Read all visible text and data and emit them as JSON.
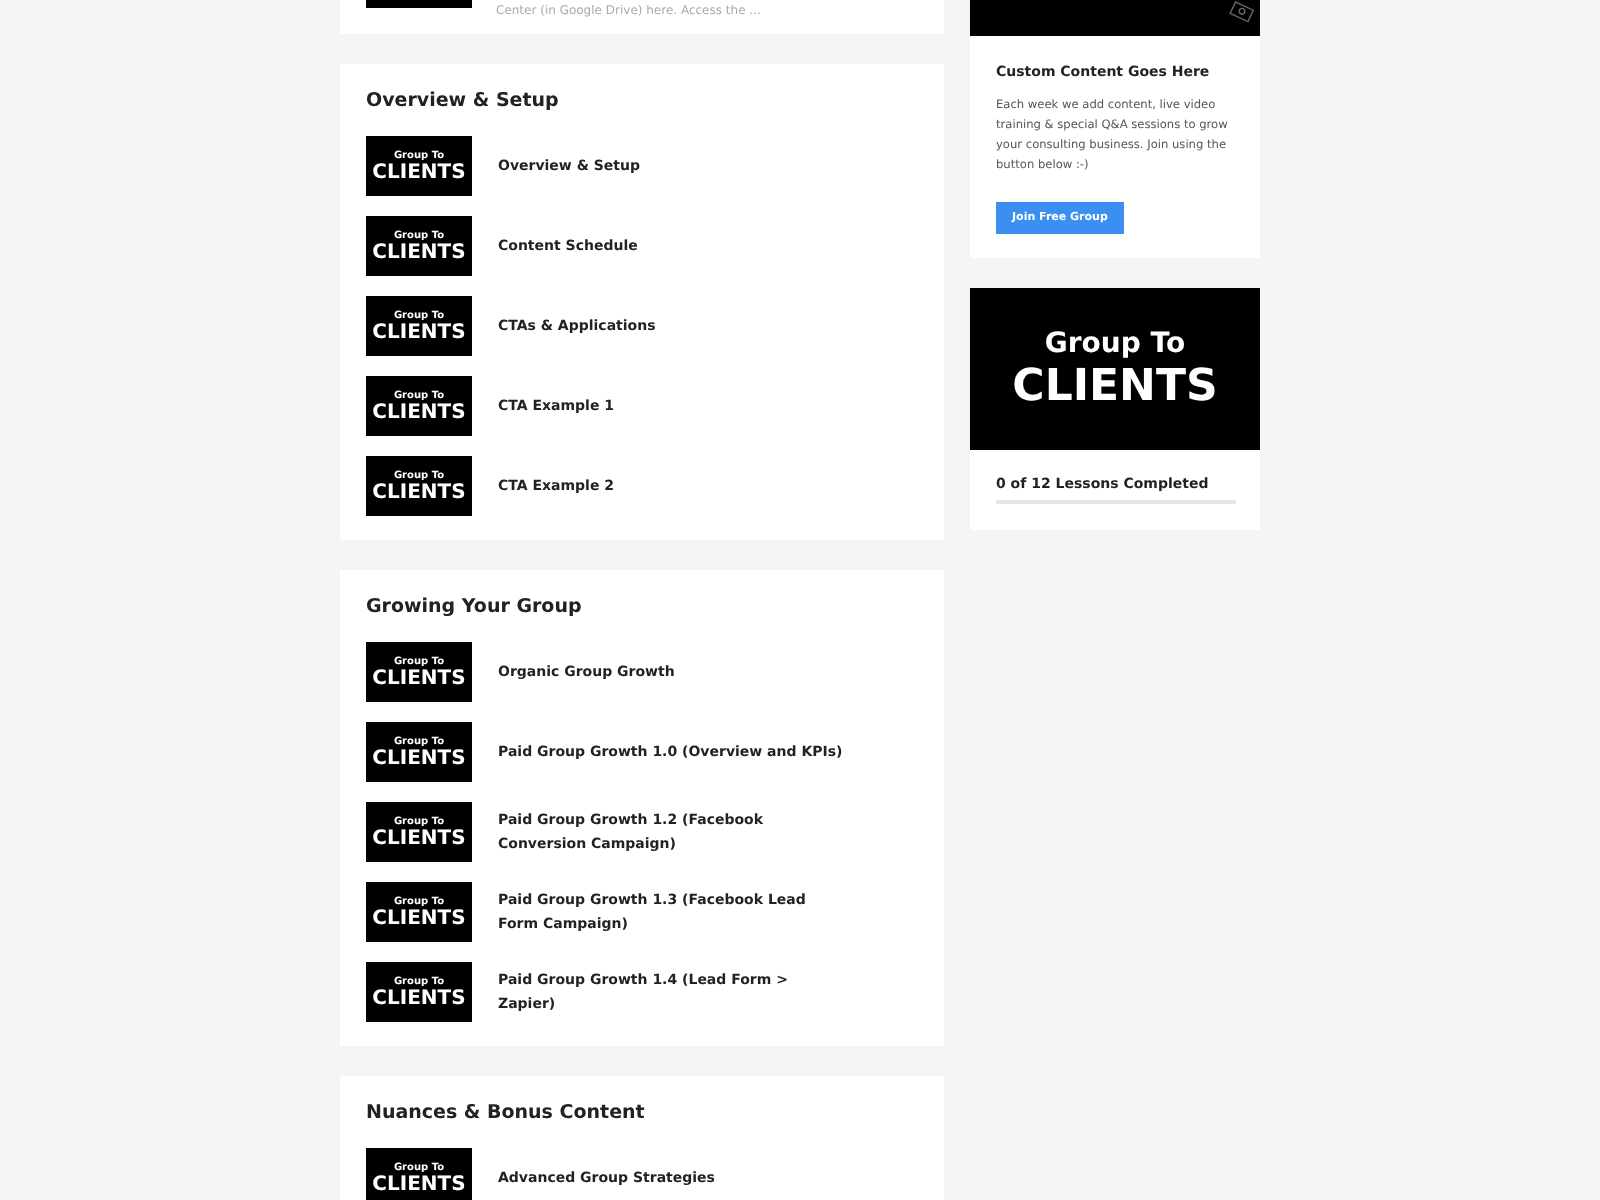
{
  "top_lesson": {
    "excerpt": "Center (in Google Drive) here. Access the ..."
  },
  "sections": [
    {
      "title": "Overview & Setup",
      "lessons": [
        {
          "title": "Overview & Setup",
          "thumbnail": {
            "line_1": "Group To",
            "line_2": "CLIENTS"
          }
        },
        {
          "title": "Content Schedule",
          "thumbnail": {
            "line_1": "Group To",
            "line_2": "CLIENTS"
          }
        },
        {
          "title": "CTAs & Applications",
          "thumbnail": {
            "line_1": "Group To",
            "line_2": "CLIENTS"
          }
        },
        {
          "title": "CTA Example 1",
          "thumbnail": {
            "line_1": "Group To",
            "line_2": "CLIENTS"
          }
        },
        {
          "title": "CTA Example 2",
          "thumbnail": {
            "line_1": "Group To",
            "line_2": "CLIENTS"
          }
        }
      ]
    },
    {
      "title": "Growing Your Group",
      "lessons": [
        {
          "title": "Organic Group Growth",
          "thumbnail": {
            "line_1": "Group To",
            "line_2": "CLIENTS"
          }
        },
        {
          "title": "Paid Group Growth 1.0 (Overview and KPIs)",
          "thumbnail": {
            "line_1": "Group To",
            "line_2": "CLIENTS"
          }
        },
        {
          "title": "Paid Group Growth 1.2 (Facebook Conversion Campaign)",
          "thumbnail": {
            "line_1": "Group To",
            "line_2": "CLIENTS"
          }
        },
        {
          "title": "Paid Group Growth 1.3 (Facebook Lead Form Campaign)",
          "thumbnail": {
            "line_1": "Group To",
            "line_2": "CLIENTS"
          }
        },
        {
          "title": "Paid Group Growth 1.4 (Lead Form > Zapier)",
          "thumbnail": {
            "line_1": "Group To",
            "line_2": "CLIENTS"
          }
        }
      ]
    },
    {
      "title": "Nuances & Bonus Content",
      "lessons": [
        {
          "title": "Advanced Group Strategies",
          "thumbnail": {
            "line_1": "Group To",
            "line_2": "CLIENTS"
          }
        }
      ]
    }
  ],
  "promo": {
    "title": "Custom Content Goes Here",
    "text": "Each week we add content, live video training & special Q&A sessions to grow your consulting business. Join using the button below :-)",
    "button": "Join Free Group"
  },
  "course": {
    "image": {
      "line_1": "Group To",
      "line_2": "CLIENTS"
    },
    "progress_text": "0 of 12 Lessons Completed",
    "level": 0
  }
}
